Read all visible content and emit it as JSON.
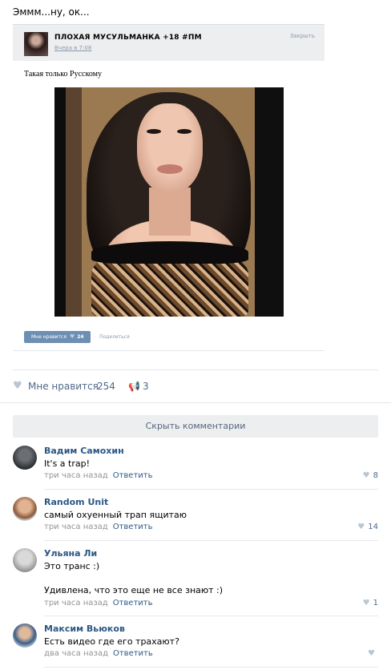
{
  "post": {
    "text": "Эммм...ну, ок..."
  },
  "shared": {
    "author": "ПЛОХАЯ МУСУЛЬМАНКА +18 #ПМ",
    "time": "Вчера в 7:08",
    "close_label": "Закрыть",
    "caption": "Такая только Русскому",
    "like_label": "Мне нравится",
    "like_count": "24",
    "share_label": "Поделиться"
  },
  "actions": {
    "like_label": "Мне нравится",
    "like_count": "254",
    "share_count": "3"
  },
  "comments_toggle": "Скрыть комментарии",
  "comments": [
    {
      "author": "Вадим Самохин",
      "text": "It's a trap!",
      "text2": "",
      "time": "три часа назад",
      "reply": "Ответить",
      "likes": "8"
    },
    {
      "author": "Random Unit",
      "text": "самый охуенный трап ящитаю",
      "text2": "",
      "time": "три часа назад",
      "reply": "Ответить",
      "likes": "14"
    },
    {
      "author": "Ульяна Ли",
      "text": "Это транс :)",
      "text2": "Удивлена, что это еще не все знают :)",
      "time": "три часа назад",
      "reply": "Ответить",
      "likes": "1"
    },
    {
      "author": "Максим Вьюков",
      "text": "Есть видео где его трахают?",
      "text2": "",
      "time": "два часа назад",
      "reply": "Ответить",
      "likes": ""
    }
  ],
  "colors": {
    "link": "#2a5885",
    "accent": "#6d8fb3",
    "muted": "#939393"
  }
}
